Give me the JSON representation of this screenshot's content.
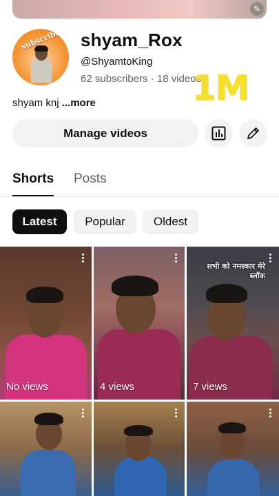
{
  "channel": {
    "name": "shyam_Rox",
    "handle": "@ShyamtoKing",
    "stats": "62 subscribers · 18 videos",
    "overlay_text": "1M",
    "description": "shyam knj",
    "more_label": "...more",
    "avatar_text": "subscribe"
  },
  "actions": {
    "manage_label": "Manage videos",
    "analytics_icon": "bar-chart-icon",
    "edit_icon": "pencil-icon"
  },
  "tabs": [
    {
      "label": "Shorts",
      "active": true
    },
    {
      "label": "Posts",
      "active": false
    }
  ],
  "chips": [
    {
      "label": "Latest",
      "selected": true
    },
    {
      "label": "Popular",
      "selected": false
    },
    {
      "label": "Oldest",
      "selected": false
    }
  ],
  "shorts": [
    {
      "views": "No views"
    },
    {
      "views": "4 views"
    },
    {
      "views": "7 views",
      "overlay": "सभी को नमस्कार मेरे ब्लॉक"
    },
    {
      "views": ""
    },
    {
      "views": ""
    },
    {
      "views": ""
    }
  ],
  "colors": {
    "accent_dark": "#0f0f0f",
    "chip_bg": "#f2f2f2",
    "overlay_yellow": "#f6e02a",
    "muted_text": "#606060"
  }
}
